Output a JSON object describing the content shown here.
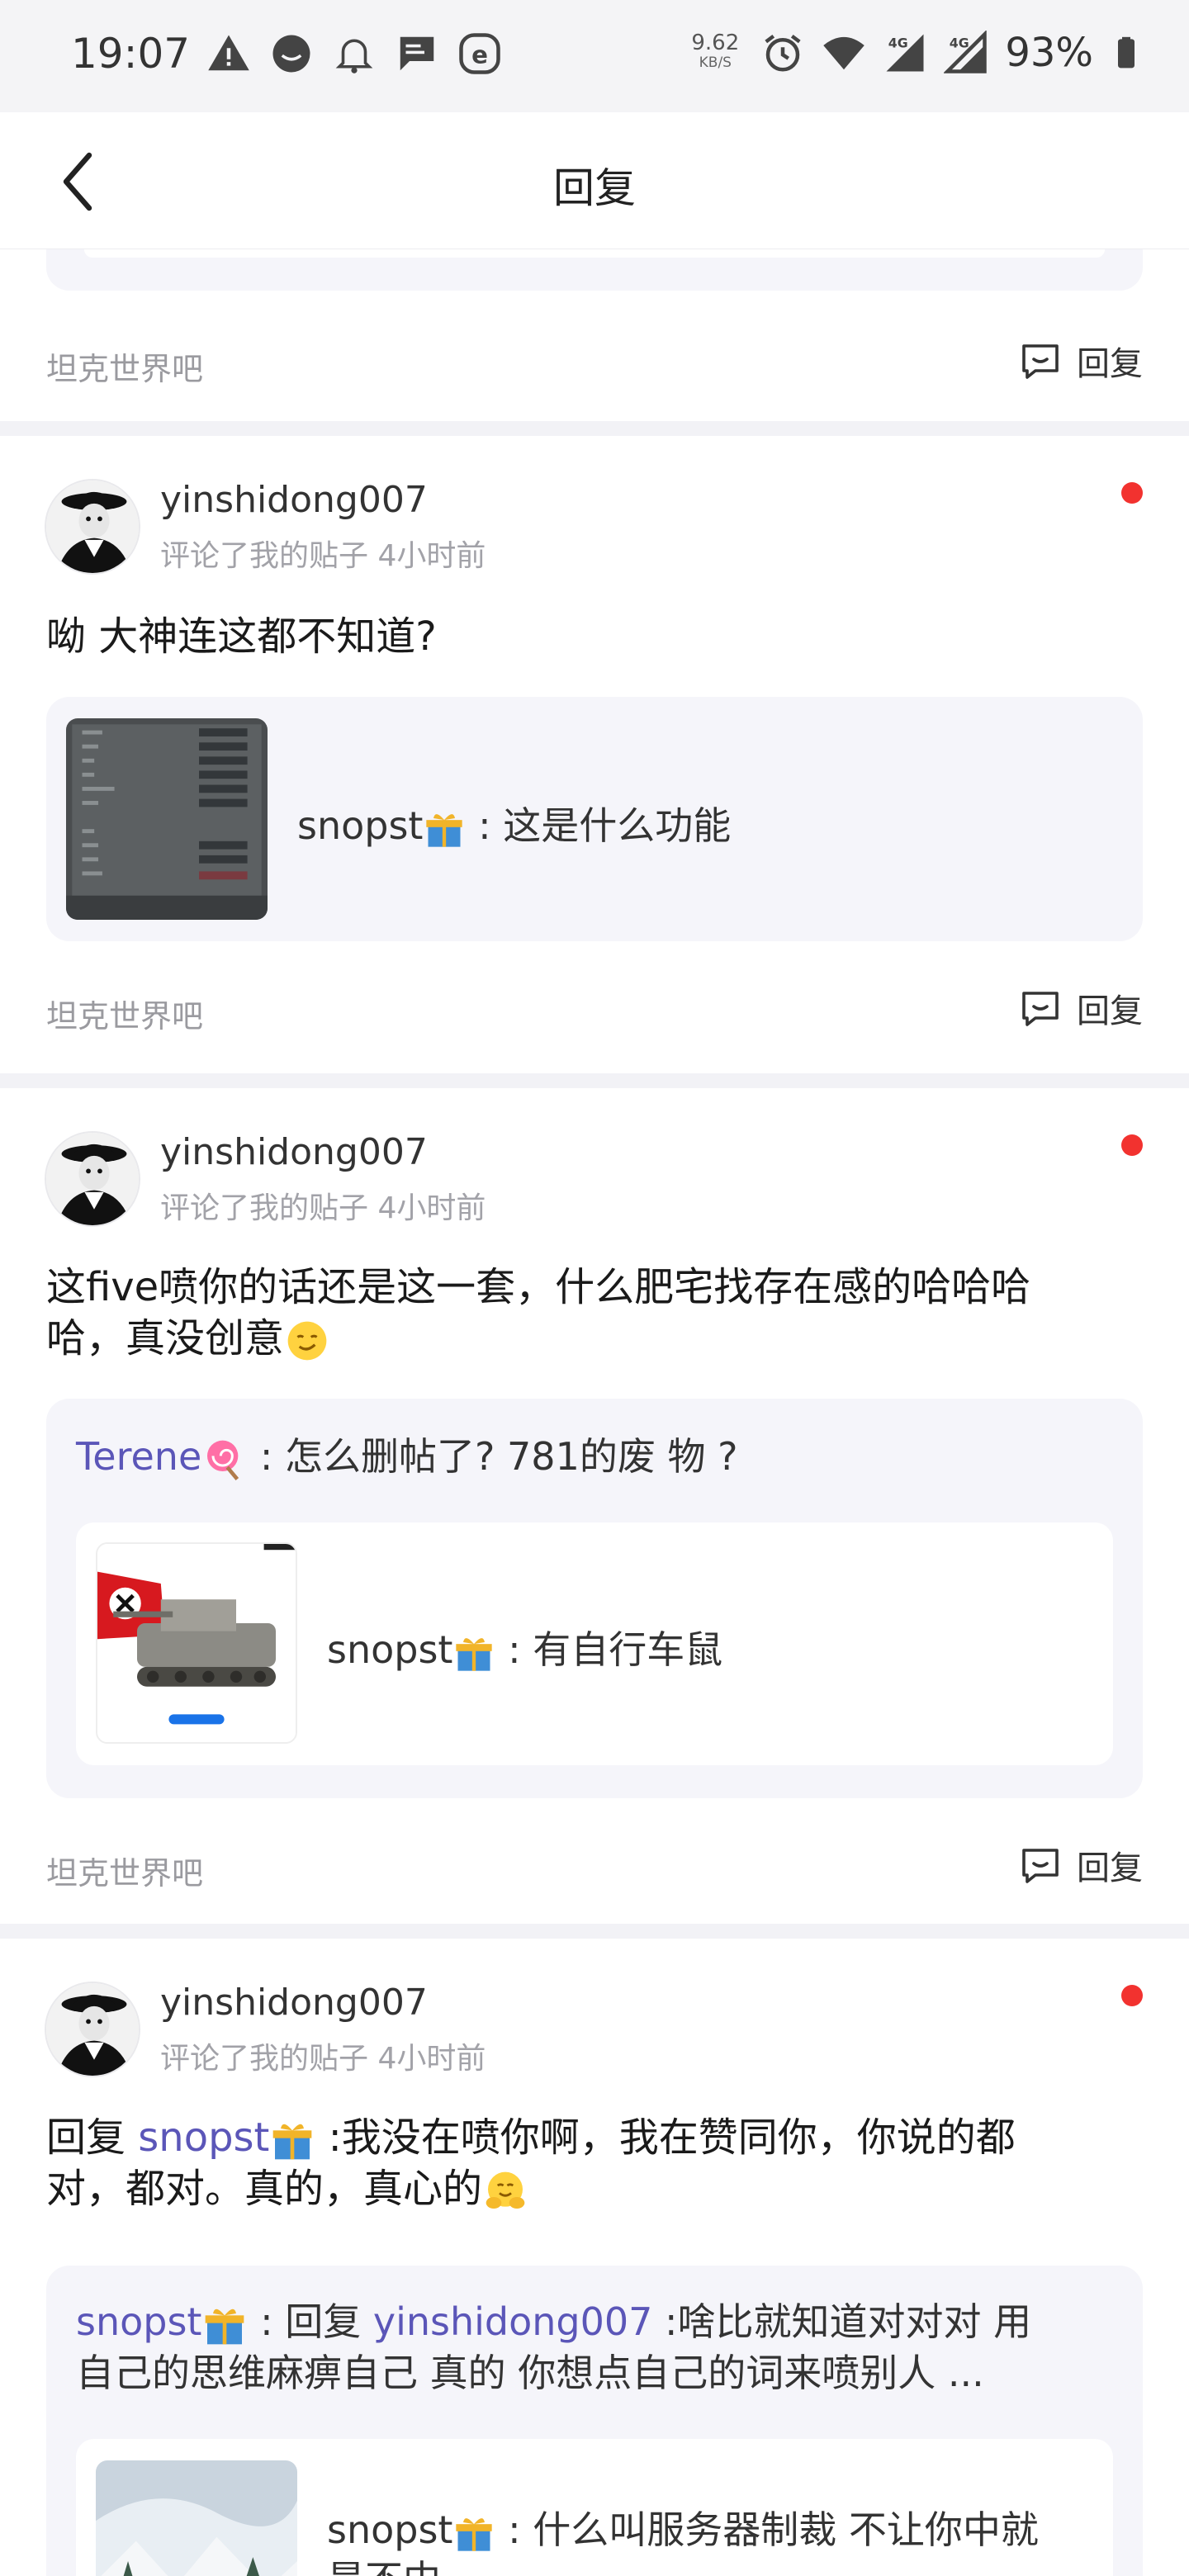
{
  "status_bar": {
    "time": "19:07",
    "net_speed": "9.62",
    "net_speed_unit": "KB/S",
    "signal_1": "4G",
    "signal_2": "4G",
    "battery": "93%"
  },
  "nav": {
    "title": "回复"
  },
  "reply_label": "回复",
  "first_footer": {
    "forum": "坦克世界吧",
    "reply": "回复"
  },
  "cards": [
    {
      "username": "yinshidong007",
      "meta": "评论了我的贴子  4小时前",
      "text": "呦 大神连这都不知道?",
      "quote": {
        "author": "snopst",
        "text": " : 这是什么功能"
      },
      "forum": "坦克世界吧"
    },
    {
      "username": "yinshidong007",
      "meta": "评论了我的贴子  4小时前",
      "text_line1": "这five喷你的话还是这一套，什么肥宅找存在感的哈哈哈",
      "text_line2": "哈，真没创意",
      "quote_author": "Terene",
      "quote_text": " : 怎么删帖了?  781的废 物 ?",
      "inner": {
        "author": "snopst",
        "text": " : 有自行车鼠"
      },
      "forum": "坦克世界吧"
    },
    {
      "username": "yinshidong007",
      "meta": "评论了我的贴子  4小时前",
      "text_prefix": "回复 ",
      "text_mention": "snopst",
      "text_rest": " :我没在喷你啊，我在赞同你，你说的都",
      "text_line2": "对，都对。真的，真心的",
      "quote_author": "snopst",
      "quote_mid": " : 回复 ",
      "quote_mention": "yinshidong007",
      "quote_rest": "  :啥比就知道对对对 用",
      "quote_line2": "自己的思维麻痹自己 真的 你想点自己的词来喷别人 ...",
      "inner": {
        "author": "snopst",
        "text_line1": " : 什么叫服务器制裁 不让你中就",
        "text_line2": "是不中"
      }
    }
  ]
}
